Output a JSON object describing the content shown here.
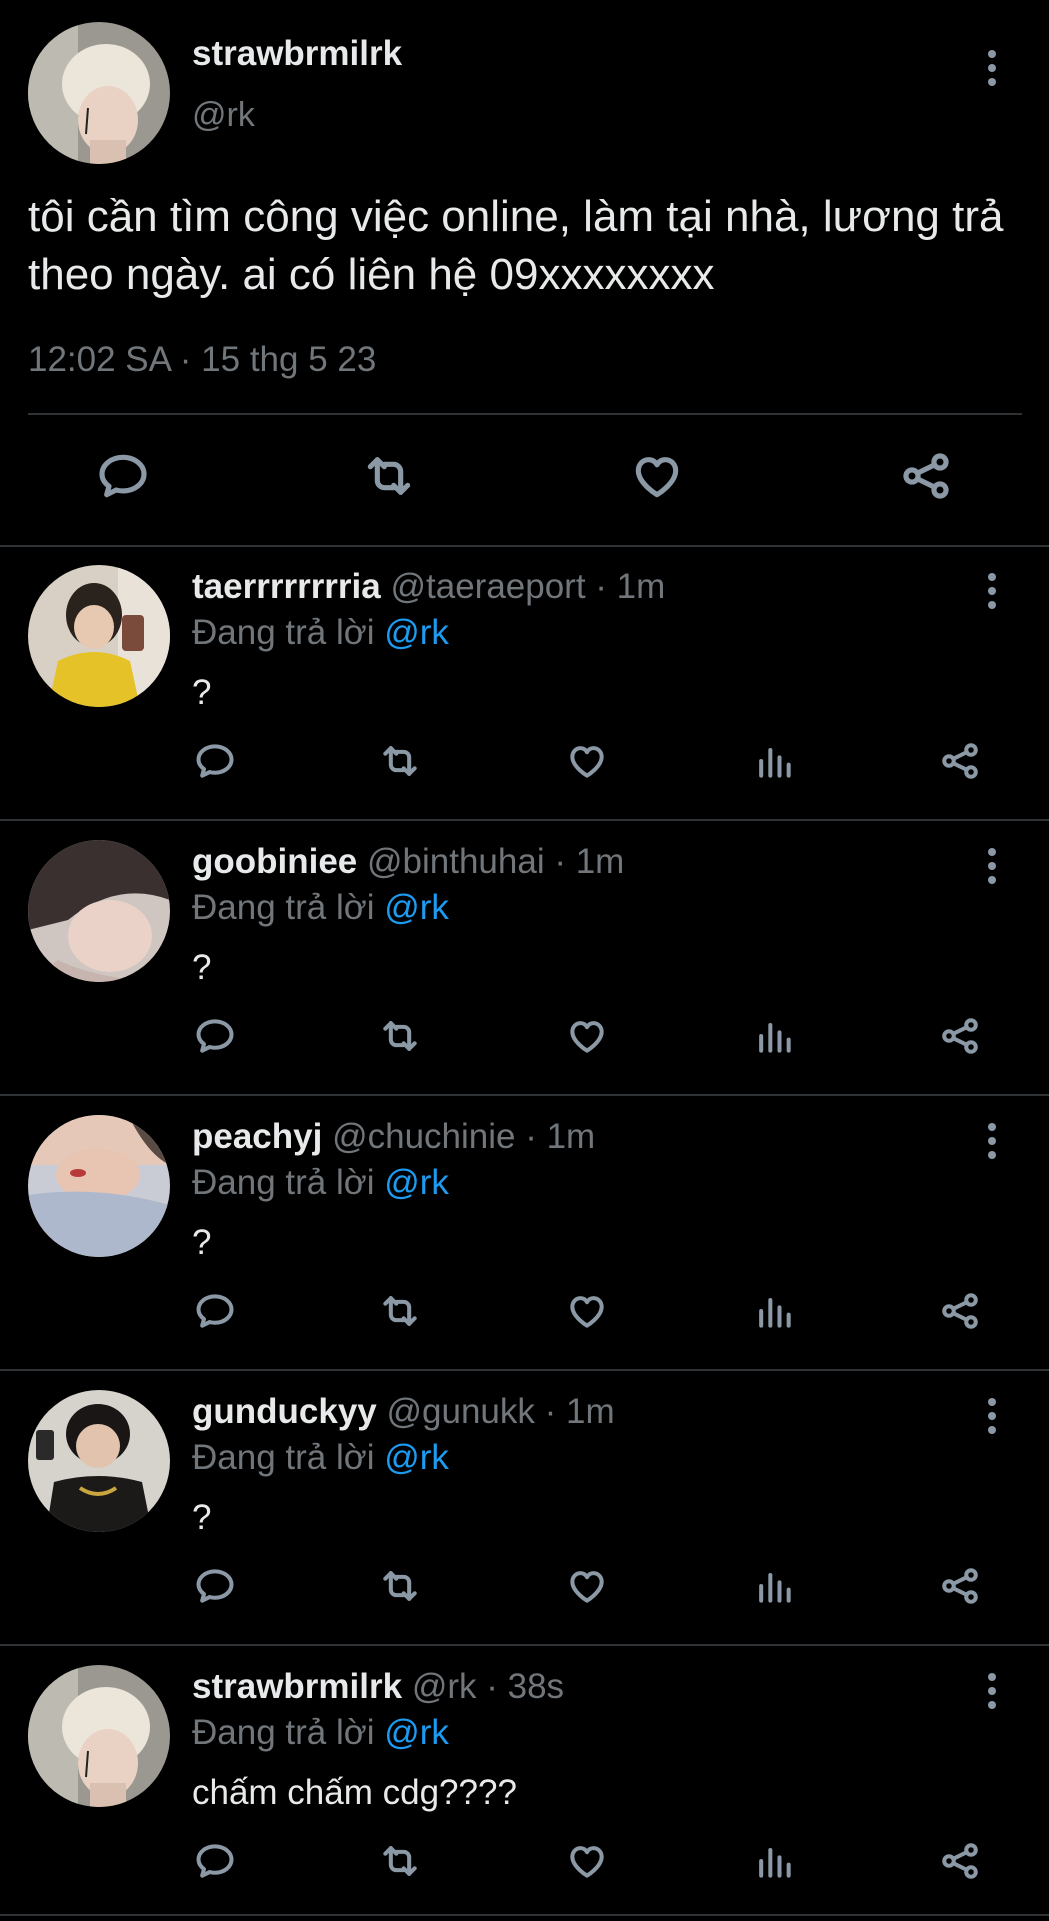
{
  "main_tweet": {
    "display_name": "strawbrmilrk",
    "handle": "@rk",
    "text": "tôi cần tìm công việc online, làm tại nhà, lương trả theo ngày. ai có liên hệ 09xxxxxxxx",
    "timestamp": "12:02 SA · 15 thg 5 23",
    "actions": [
      "reply-icon",
      "retweet-icon",
      "like-icon",
      "share-icon"
    ]
  },
  "replies": [
    {
      "display_name": "taerrrrrrrria",
      "meta": " @taeraeport · 1m",
      "replying_prefix": "Đang trả lời ",
      "replying_to": "@rk",
      "text": "?"
    },
    {
      "display_name": "goobiniee",
      "meta": " @binthuhai · 1m",
      "replying_prefix": "Đang trả lời ",
      "replying_to": "@rk",
      "text": "?"
    },
    {
      "display_name": "peachyj",
      "meta": " @chuchinie · 1m",
      "replying_prefix": "Đang trả lời ",
      "replying_to": "@rk",
      "text": "?"
    },
    {
      "display_name": "gunduckyy",
      "meta": " @gunukk · 1m",
      "replying_prefix": "Đang trả lời ",
      "replying_to": "@rk",
      "text": "?"
    },
    {
      "display_name": "strawbrmilrk",
      "meta": " @rk · 38s",
      "replying_prefix": "Đang trả lời ",
      "replying_to": "@rk",
      "text": "chấm chấm cdg????"
    }
  ],
  "colors": {
    "background": "#000000",
    "primary_text": "#e7e9ea",
    "secondary_text": "#71767b",
    "mention": "#1d9bf0",
    "divider": "#2f3336",
    "icon": "#8b98a5"
  }
}
